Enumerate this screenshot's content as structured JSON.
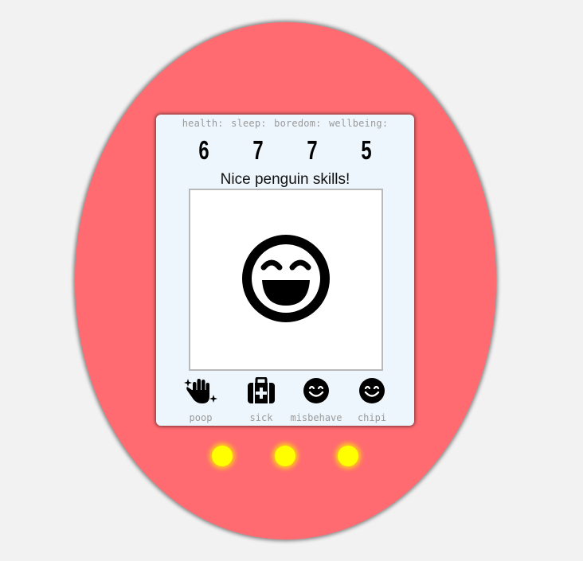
{
  "stats": {
    "labels": [
      "health:",
      "sleep:",
      "boredom:",
      "wellbeing:"
    ],
    "values": [
      "6",
      "7",
      "7",
      "5"
    ]
  },
  "message": "Nice penguin skills!",
  "pet": {
    "mood_icon": "grinning-face-icon"
  },
  "actions": [
    {
      "label": "poop",
      "icon": "clean-hand-sparkles-icon"
    },
    {
      "label": "sick",
      "icon": "first-aid-kit-icon"
    },
    {
      "label": "misbehave",
      "icon": "smile-icon"
    },
    {
      "label": "chipi",
      "icon": "smile-icon"
    }
  ],
  "colors": {
    "shell": "#ff6b70",
    "screen": "#eef6fd",
    "led": "#ffff00",
    "background": "#f2f2f2"
  }
}
